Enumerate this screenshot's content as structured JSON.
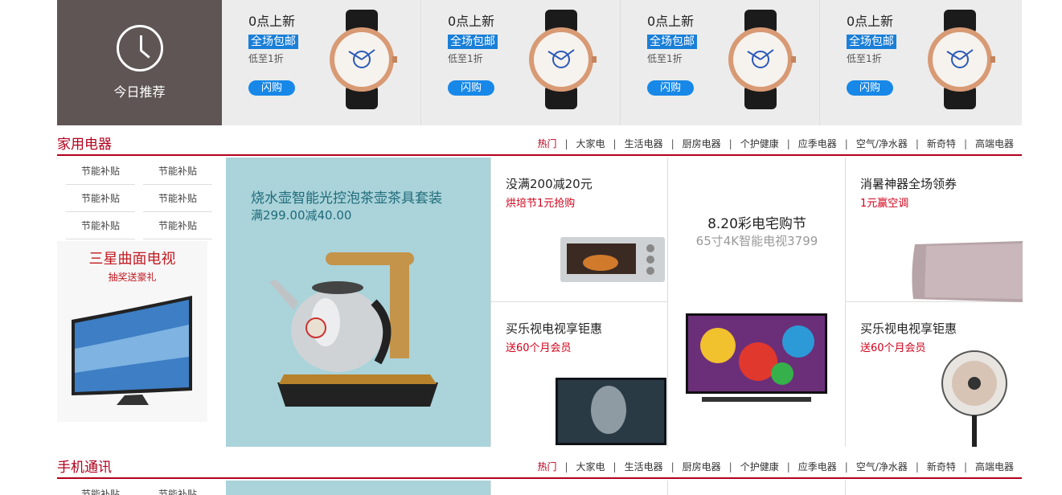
{
  "today": {
    "label": "今日推荐",
    "deals": [
      {
        "title": "0点上新",
        "badge": "全场包邮",
        "sub": "低至1折",
        "button": "闪购"
      },
      {
        "title": "0点上新",
        "badge": "全场包邮",
        "sub": "低至1折",
        "button": "闪购"
      },
      {
        "title": "0点上新",
        "badge": "全场包邮",
        "sub": "低至1折",
        "button": "闪购"
      },
      {
        "title": "0点上新",
        "badge": "全场包邮",
        "sub": "低至1折",
        "button": "闪购"
      }
    ]
  },
  "section1": {
    "title": "家用电器",
    "tabs": [
      "热门",
      "大家电",
      "生活电器",
      "厨房电器",
      "个护健康",
      "应季电器",
      "空气/净水器",
      "新奇特",
      "高端电器"
    ],
    "sub_links": [
      "节能补贴",
      "节能补贴",
      "节能补贴",
      "节能补贴",
      "节能补贴",
      "节能补贴"
    ],
    "tv_card": {
      "title": "三星曲面电视",
      "sub": "抽奖送豪礼"
    },
    "kettle": {
      "title": "烧水壶智能光控泡茶壶茶具套装",
      "sub": "满299.00减40.00"
    },
    "oven": {
      "title": "没满200减20元",
      "sub": "烘培节1元抢购"
    },
    "center": {
      "title": "8.20彩电宅购节",
      "sub": "65寸4K智能电视3799"
    },
    "aircon": {
      "title": "消暑神器全场领券",
      "sub": "1元赢空调"
    },
    "tv_promo": {
      "title": "买乐视电视享钜惠",
      "sub": "送60个月会员"
    },
    "fan_promo": {
      "title": "买乐视电视享钜惠",
      "sub": "送60个月会员"
    }
  },
  "section2": {
    "title": "手机通讯",
    "tabs": [
      "热门",
      "大家电",
      "生活电器",
      "厨房电器",
      "个护健康",
      "应季电器",
      "空气/净水器",
      "新奇特",
      "高端电器"
    ],
    "sub_links": [
      "节能补贴",
      "节能补贴"
    ]
  },
  "colors": {
    "accent_red": "#b3001e",
    "brand_blue": "#1788e8",
    "today_bg": "#5e5554",
    "teal_panel": "#aad3da"
  }
}
